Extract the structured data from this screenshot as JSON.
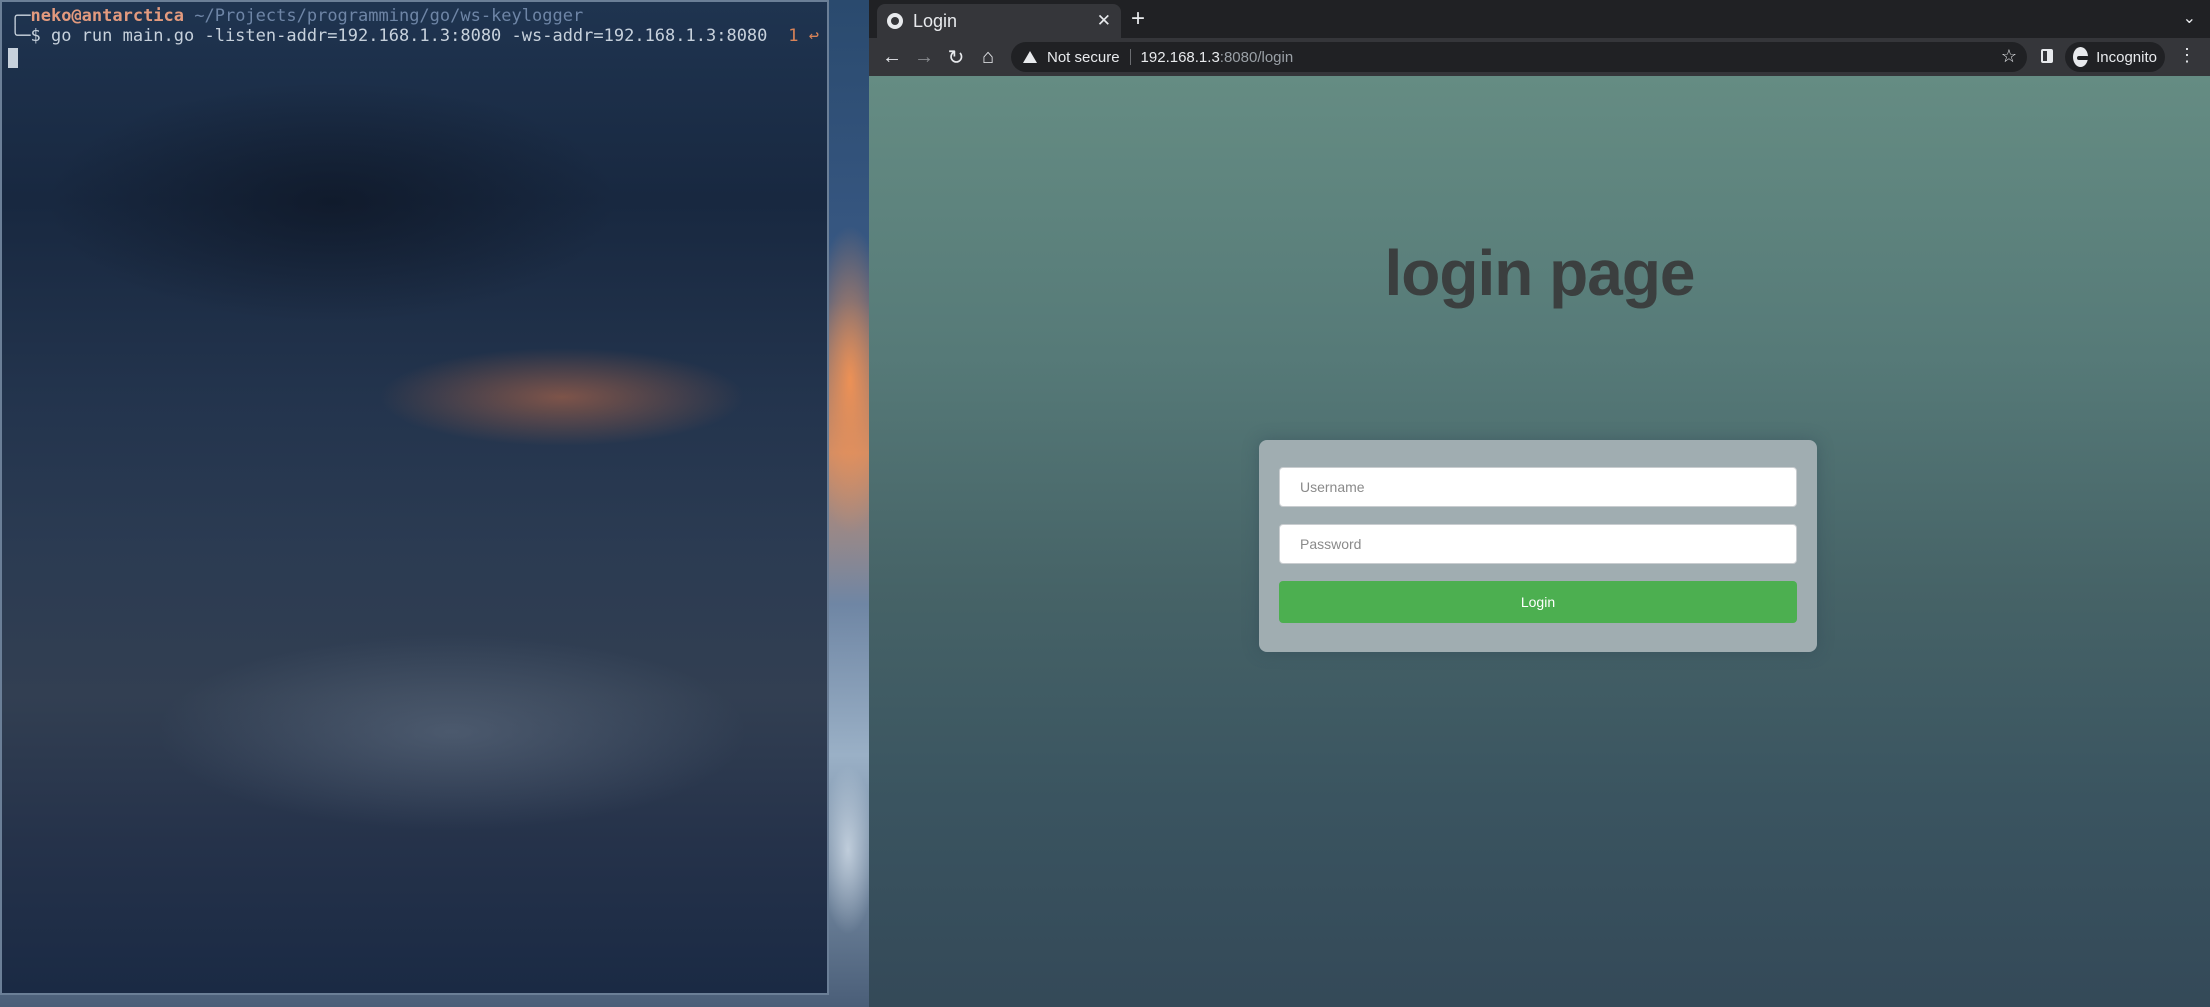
{
  "terminal": {
    "prompt_prefix": "╭─",
    "user_host": "neko@antarctica",
    "cwd": "~/Projects/programming/go/ws-keylogger",
    "prompt_symbol": "╰─$ ",
    "command": "go run main.go -listen-addr=192.168.1.3:8080 -ws-addr=192.168.1.3:8080",
    "exit_status": "1 ↩"
  },
  "browser": {
    "tab": {
      "title": "Login",
      "icon": "globe-icon",
      "close": "✕"
    },
    "new_tab": "+",
    "tab_dropdown": "⌄",
    "nav": {
      "back": "←",
      "forward": "→",
      "reload": "↻",
      "home": "⌂"
    },
    "address": {
      "security": "Not secure",
      "host": "192.168.1.3",
      "path": ":8080/login"
    },
    "star": "☆",
    "incognito_label": "Incognito",
    "menu": "⋮"
  },
  "page": {
    "heading": "login page",
    "username_placeholder": "Username",
    "password_placeholder": "Password",
    "login_label": "Login"
  },
  "colors": {
    "login_button": "#4caf50",
    "username_color": "#e39a7e",
    "path_color": "#6e85a6",
    "status_color": "#d98358"
  }
}
